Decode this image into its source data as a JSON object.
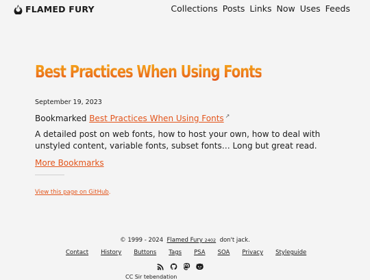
{
  "header": {
    "brand": "FLAMED FURY",
    "nav": [
      "Collections",
      "Posts",
      "Links",
      "Now",
      "Uses",
      "Feeds"
    ]
  },
  "post": {
    "title": "Best Practices When Using Fonts",
    "date": "September 19, 2023",
    "bookmark_prefix": "Bookmarked",
    "bookmark_link": "Best Practices When Using Fonts",
    "description": "A detailed post on web fonts, how to host your own, how to deal with unstyled content, variable fonts, subset fonts… Long but great read.",
    "more_link": "More Bookmarks",
    "github_link": "View this page on GitHub",
    "github_suffix": "."
  },
  "footer": {
    "copyright_prefix": "© 1999 - 2024",
    "site_name": "Flamed Fury",
    "version": "2402",
    "tagline": "don't jack.",
    "links": [
      "Contact",
      "History",
      "Buttons",
      "Tags",
      "PSA",
      "SOA",
      "Privacy",
      "Styleguide"
    ],
    "social_icons": [
      "rss-icon",
      "github-icon",
      "mastodon-icon",
      "omg-lol-icon"
    ],
    "cutoff_text": "CC Sir tebendation"
  },
  "colors": {
    "accent": "#e3541a",
    "title_gradient_top": "#f6b01c",
    "title_gradient_bottom": "#e4541e",
    "background": "#f4f4f4"
  }
}
